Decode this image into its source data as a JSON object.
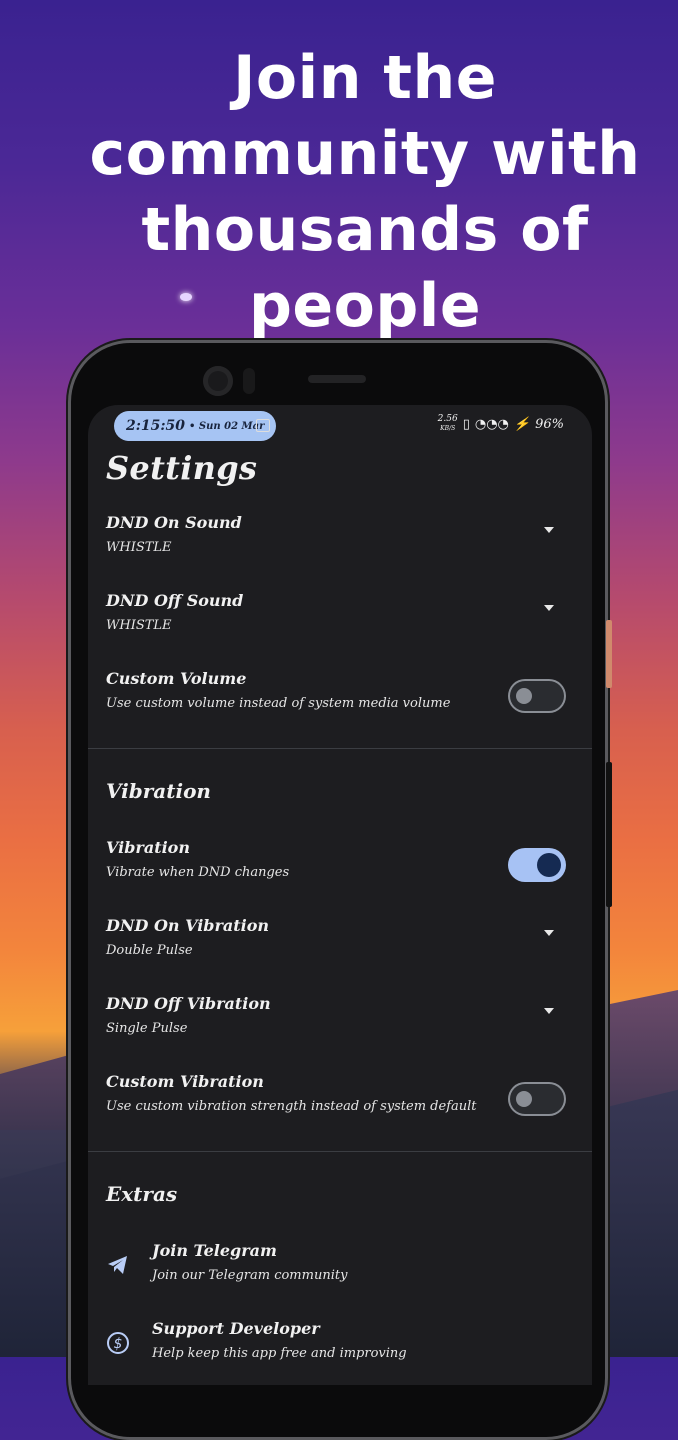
{
  "headline": "Join the community with thousands of people",
  "status_bar": {
    "time": "2:15:50",
    "date": "• Sun 02 Mar",
    "speed_value": "2.56",
    "speed_unit": "KB/S",
    "battery": "96%"
  },
  "settings": {
    "title": "Settings",
    "items": [
      {
        "label": "DND On Sound",
        "sub": "WHISTLE"
      },
      {
        "label": "DND Off Sound",
        "sub": "WHISTLE"
      },
      {
        "label": "Custom Volume",
        "sub": "Use custom volume instead of system media volume",
        "toggle": false
      }
    ]
  },
  "vibration": {
    "title": "Vibration",
    "items": [
      {
        "label": "Vibration",
        "sub": "Vibrate when DND changes",
        "toggle": true
      },
      {
        "label": "DND On Vibration",
        "sub": "Double Pulse"
      },
      {
        "label": "DND Off Vibration",
        "sub": "Single Pulse"
      },
      {
        "label": "Custom Vibration",
        "sub": "Use custom vibration strength instead of system default",
        "toggle": false
      }
    ]
  },
  "extras": {
    "title": "Extras",
    "items": [
      {
        "label": "Join Telegram",
        "sub": "Join our Telegram community",
        "icon": "telegram-icon"
      },
      {
        "label": "Support Developer",
        "sub": "Help keep this app free and improving",
        "icon": "dollar-circle-icon"
      }
    ]
  },
  "colors": {
    "accent": "#a7c2f4",
    "screen_bg": "#1d1d20"
  }
}
